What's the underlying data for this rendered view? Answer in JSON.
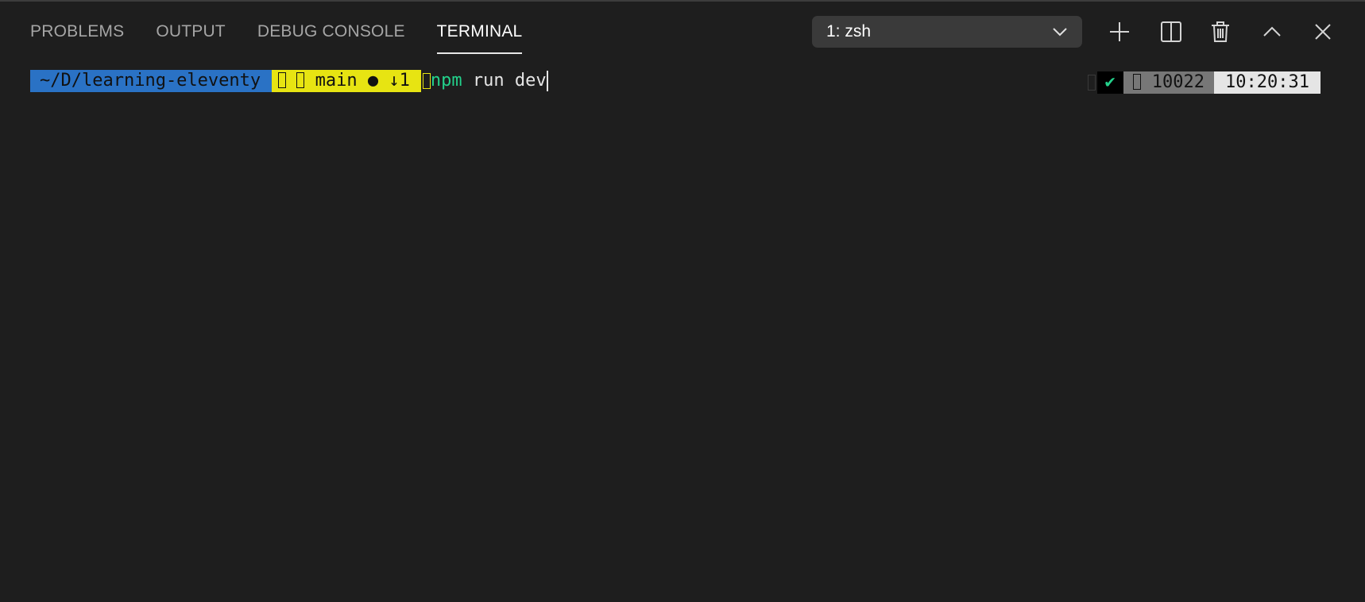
{
  "panel": {
    "tabs": [
      {
        "label": "PROBLEMS",
        "active": false
      },
      {
        "label": "OUTPUT",
        "active": false
      },
      {
        "label": "DEBUG CONSOLE",
        "active": false
      },
      {
        "label": "TERMINAL",
        "active": true
      }
    ],
    "terminal_selector": {
      "value": "1: zsh",
      "icon": "chevron-down-icon"
    },
    "actions": [
      {
        "name": "new-terminal",
        "icon": "plus-icon"
      },
      {
        "name": "split-terminal",
        "icon": "split-icon"
      },
      {
        "name": "kill-terminal",
        "icon": "trash-icon"
      },
      {
        "name": "maximize-panel",
        "icon": "chevron-up-icon"
      },
      {
        "name": "close-panel",
        "icon": "close-icon"
      }
    ]
  },
  "terminal": {
    "prompt": {
      "directory": "~/D/learning-eleventy",
      "branch": "main",
      "git_status": "● ↓1"
    },
    "command": {
      "program": "npm",
      "args": " run dev"
    },
    "right_prompt": {
      "status": "✔",
      "id": "10022",
      "time": "10:20:31"
    }
  },
  "colors": {
    "background": "#1e1e1e",
    "dir_segment": "#2a72c5",
    "git_segment": "#e7e412",
    "command_green": "#23d18b",
    "time_segment": "#e5e5e5"
  }
}
